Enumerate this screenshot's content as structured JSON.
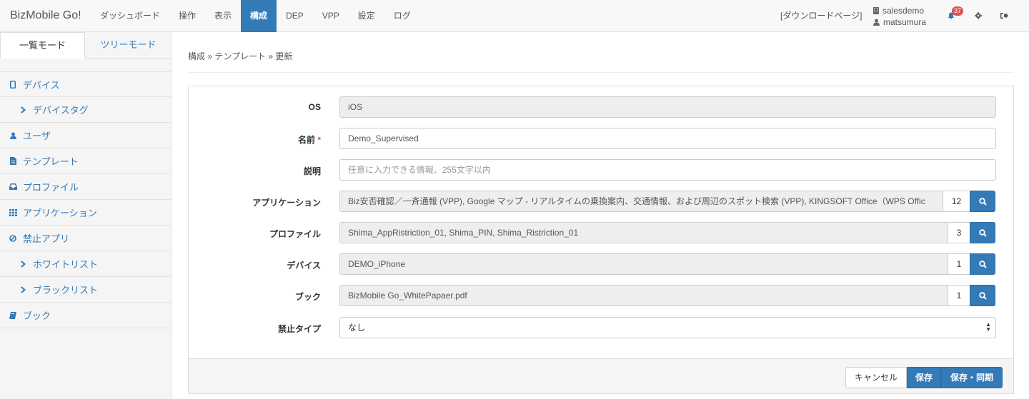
{
  "navbar": {
    "brand": "BizMobile Go!",
    "items": [
      "ダッシュボード",
      "操作",
      "表示",
      "構成",
      "DEP",
      "VPP",
      "設定",
      "ログ"
    ],
    "active_index": 3,
    "download_link": "[ダウンロードページ]",
    "org": "salesdemo",
    "user": "matsumura",
    "notification_count": "37"
  },
  "sidebar": {
    "tabs": [
      "一覧モード",
      "ツリーモード"
    ],
    "items": [
      {
        "label": "デバイス",
        "icon": "mobile-icon"
      },
      {
        "label": "デバイスタグ",
        "icon": "chevron-right-icon"
      },
      {
        "label": "ユーザ",
        "icon": "user-icon"
      },
      {
        "label": "テンプレート",
        "icon": "file-icon"
      },
      {
        "label": "プロファイル",
        "icon": "inbox-icon"
      },
      {
        "label": "アプリケーション",
        "icon": "grid-icon"
      },
      {
        "label": "禁止アプリ",
        "icon": "ban-icon"
      },
      {
        "label": "ホワイトリスト",
        "icon": "chevron-right-icon"
      },
      {
        "label": "ブラックリスト",
        "icon": "chevron-right-icon"
      },
      {
        "label": "ブック",
        "icon": "book-icon"
      }
    ]
  },
  "breadcrumb": "構成 » テンプレート » 更新",
  "form": {
    "os": {
      "label": "OS",
      "value": "iOS"
    },
    "name": {
      "label": "名前",
      "required_mark": "*",
      "value": "Demo_Supervised"
    },
    "description": {
      "label": "説明",
      "placeholder": "任意に入力できる情報。255文字以内"
    },
    "applications": {
      "label": "アプリケーション",
      "value": "Biz安否確認／一斉通報 (VPP), Google マップ - リアルタイムの乗換案内、交通情報、および周辺のスポット検索 (VPP), KINGSOFT Office（WPS Offic",
      "count": "12"
    },
    "profiles": {
      "label": "プロファイル",
      "value": "Shima_AppRistriction_01, Shima_PIN, Shima_Ristriction_01",
      "count": "3"
    },
    "devices": {
      "label": "デバイス",
      "value": "DEMO_iPhone",
      "count": "1"
    },
    "books": {
      "label": "ブック",
      "value": "BizMobile Go_WhitePapaer.pdf",
      "count": "1"
    },
    "ban_type": {
      "label": "禁止タイプ",
      "value": "なし"
    }
  },
  "buttons": {
    "cancel": "キャンセル",
    "save": "保存",
    "save_sync": "保存・同期"
  },
  "colors": {
    "primary": "#337ab7",
    "badge": "#d9534f"
  }
}
